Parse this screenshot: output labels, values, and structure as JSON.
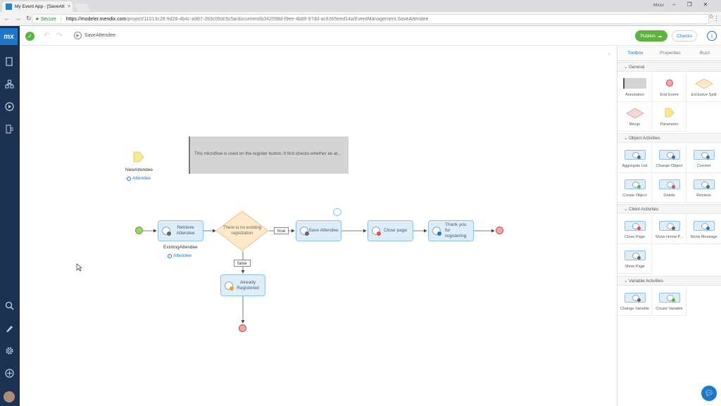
{
  "browser": {
    "tab_title": "My Event App - [SaveAtt",
    "tab_close": "×",
    "user": "Mxxx",
    "window_controls": [
      "–",
      "❐",
      "✕"
    ],
    "secure_label": "Secure",
    "url_host": "https://modeler.mendix.com",
    "url_path": "/project/11013c28-9d28-4b4c-a987-393c06dc5c5a/document/b342098d-f9ee-4b88-97dd-ac8365eed14a/EventManagement.SaveAttendee"
  },
  "leftnav": {
    "logo": "mx"
  },
  "toolbar": {
    "document_name": "SaveAttendee",
    "publish_label": "Publish",
    "checks_label": "Checks"
  },
  "canvas": {
    "parameter_name": "NewAttendee",
    "parameter_type": "Attendee",
    "annotation_text": "This microflow is used on the register button. It first checks whether an at...",
    "retrieve_label": "Retrieve Attendee",
    "retrieve_output": "ExistingAttendee",
    "retrieve_output_type": "Attendee",
    "split_label": "There is no existing registration",
    "true_label": "true",
    "false_label": "false",
    "save_label": "Save Attendee",
    "close_label": "Close page",
    "thanks_label": "Thank you for registering",
    "already_label": "Already Registered"
  },
  "panel": {
    "tabs": [
      "Toolbox",
      "Properties",
      "Buzz"
    ],
    "sections": [
      {
        "title": "General",
        "items": [
          "Annotation",
          "End Event",
          "Exclusive Split",
          "Merge",
          "Parameter"
        ]
      },
      {
        "title": "Object Activities",
        "items": [
          "Aggregate List",
          "Change Object",
          "Commit",
          "Create Object",
          "Delete",
          "Retrieve"
        ]
      },
      {
        "title": "Client Activities",
        "items": [
          "Close Page",
          "Show Home P...",
          "Show Message",
          "Show Page"
        ]
      },
      {
        "title": "Variable Activities",
        "items": [
          "Change Variable",
          "Create Variable"
        ]
      }
    ]
  },
  "colors": {
    "green": "#5ab43d",
    "blue": "#1f77c8",
    "nav": "#1b3252",
    "activity_fill": "#ddeefa",
    "split_fill": "#fde9c8",
    "end_event": "#f4a6a6"
  }
}
